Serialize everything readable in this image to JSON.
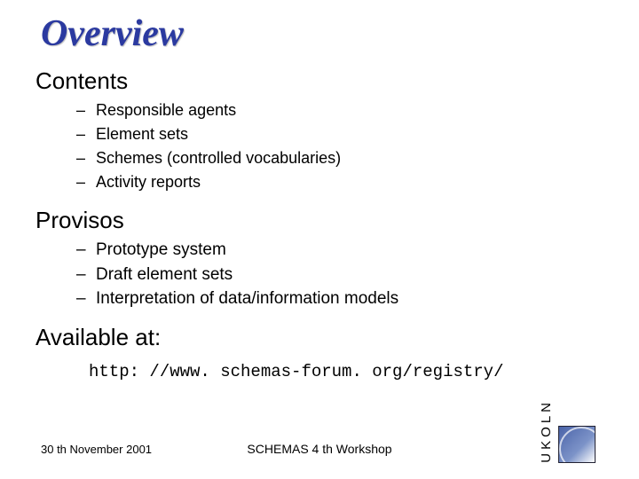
{
  "title": "Overview",
  "sections": [
    {
      "heading": "Contents",
      "items": [
        "Responsible agents",
        "Element sets",
        "Schemes (controlled vocabularies)",
        "Activity reports"
      ]
    },
    {
      "heading": "Provisos",
      "items": [
        "Prototype system",
        "Draft element sets",
        "Interpretation of data/information models"
      ]
    },
    {
      "heading": "Available at:",
      "url": "http: //www. schemas-forum. org/registry/"
    }
  ],
  "footer": {
    "date": "30 th November 2001",
    "center": "SCHEMAS 4 th Workshop",
    "logo_text": "UKOLN"
  }
}
